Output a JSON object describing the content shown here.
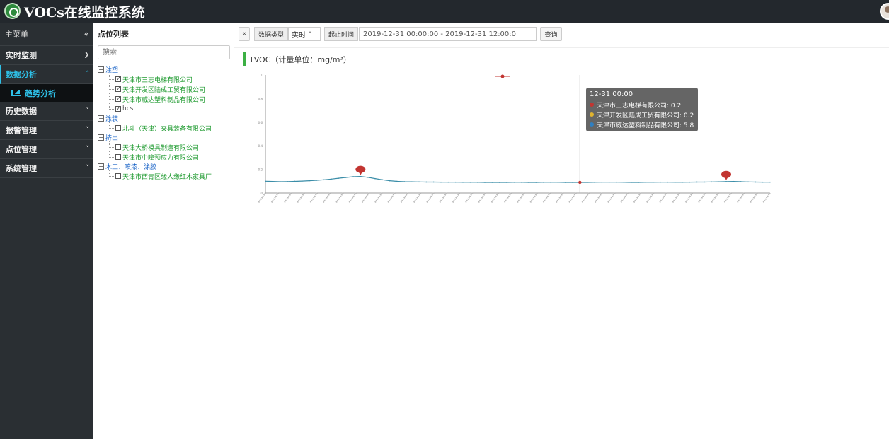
{
  "app": {
    "title": "VOCs在线监控系统"
  },
  "sidebar": {
    "header": "主菜单",
    "collapse_icon": "«",
    "items": [
      {
        "label": "实时监测",
        "expanded": false
      },
      {
        "label": "数据分析",
        "expanded": true,
        "active": true
      },
      {
        "label": "历史数据",
        "expanded": false
      },
      {
        "label": "报警管理",
        "expanded": false
      },
      {
        "label": "点位管理",
        "expanded": false
      },
      {
        "label": "系统管理",
        "expanded": false
      }
    ],
    "sub_item": {
      "label": "趋势分析",
      "icon": "area-chart-icon"
    }
  },
  "tree_panel": {
    "title": "点位列表",
    "search_placeholder": "搜索",
    "groups": [
      {
        "label": "注塑",
        "items": [
          {
            "label": "天津市三志电梯有限公司",
            "checked": true
          },
          {
            "label": "天津开发区陆成工贸有限公司",
            "checked": true
          },
          {
            "label": "天津市威达塑料制品有限公司",
            "checked": true
          },
          {
            "label": "hcs",
            "checked": true
          }
        ]
      },
      {
        "label": "涂装",
        "items": [
          {
            "label": "北斗（天津）夹具装备有限公司",
            "checked": false
          }
        ]
      },
      {
        "label": "挤出",
        "items": [
          {
            "label": "天津大桥模具制造有限公司",
            "checked": false
          },
          {
            "label": "天津市中瞳预应力有限公司",
            "checked": false
          }
        ]
      },
      {
        "label": "木工、喷漆、涂胶",
        "items": [
          {
            "label": "天津市西青区缘人缘红木家具厂",
            "checked": false
          }
        ]
      }
    ]
  },
  "toolbar": {
    "collapse_label": "«",
    "data_type_label": "数据类型",
    "data_type_value": "实时",
    "time_range_label": "起止时间",
    "time_range_value": "2019-12-31 00:00:00 - 2019-12-31 12:00:0",
    "query_label": "查询"
  },
  "chart_header": {
    "title": "TVOC（计量单位：mg/m³）"
  },
  "tooltip": {
    "time": "12-31 00:00",
    "rows": [
      {
        "label": "天津市三志电梯有限公司: 0.2",
        "color": "#c23531"
      },
      {
        "label": "天津开发区陆成工贸有限公司: 0.2",
        "color": "#e0b32f"
      },
      {
        "label": "天津市威达塑料制品有限公司: 5.8",
        "color": "#2f7fc1"
      }
    ]
  },
  "colors": {
    "accent": "#2ec0e8",
    "series": "#3a8da8",
    "markpoint": "#c23531",
    "title_bar": "#3cb044"
  },
  "chart_data": {
    "type": "line",
    "ylim": [
      0,
      1
    ],
    "yticks": [
      "0",
      "0.2",
      "0.4",
      "0.6",
      "0.8",
      "1"
    ],
    "legend": "top",
    "grid": false,
    "series": [
      {
        "values": [
          0.1,
          0.098,
          0.096,
          0.097,
          0.099,
          0.101,
          0.104,
          0.108,
          0.112,
          0.118,
          0.125,
          0.132,
          0.138,
          0.14,
          0.133,
          0.122,
          0.112,
          0.104,
          0.099,
          0.096,
          0.095,
          0.094,
          0.093,
          0.093,
          0.092,
          0.092,
          0.092,
          0.091,
          0.091,
          0.091,
          0.09,
          0.09,
          0.09,
          0.09,
          0.091,
          0.091,
          0.09,
          0.09,
          0.091,
          0.091,
          0.091,
          0.09,
          0.09,
          0.09,
          0.09,
          0.091,
          0.092,
          0.092,
          0.092,
          0.091,
          0.09,
          0.09,
          0.091,
          0.091,
          0.092,
          0.092,
          0.091,
          0.091,
          0.092,
          0.093,
          0.093,
          0.094,
          0.095,
          0.097,
          0.098,
          0.096,
          0.094,
          0.093,
          0.092,
          0.092
        ]
      }
    ]
  }
}
